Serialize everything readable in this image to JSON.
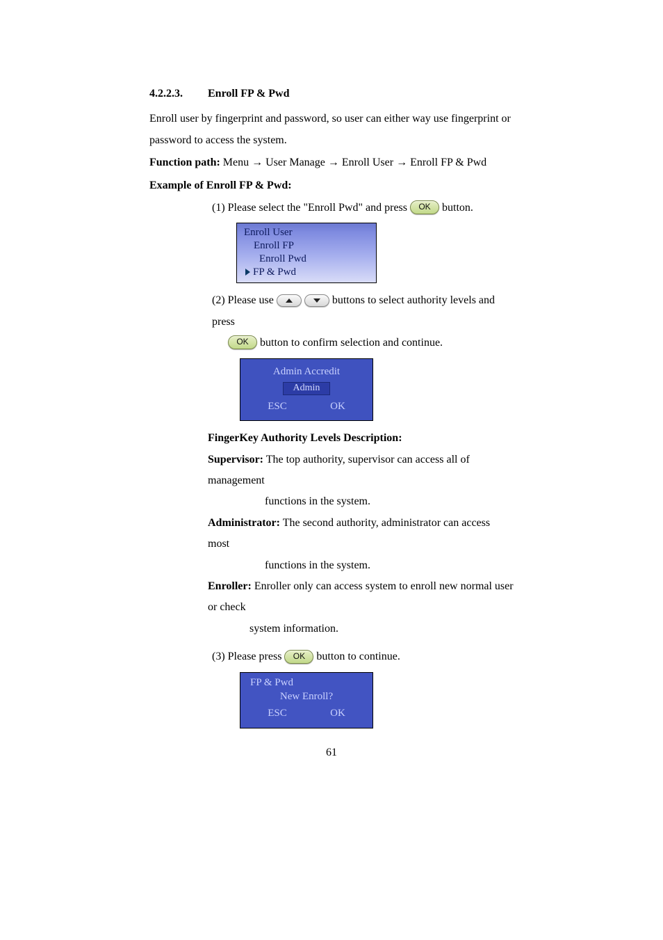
{
  "heading": {
    "number": "4.2.2.3.",
    "title": "Enroll FP & Pwd"
  },
  "intro": "Enroll user by fingerprint and password, so user can either way use fingerprint or password to access the system.",
  "fpath": {
    "label": "Function path:",
    "value": " Menu → User Manage → Enroll User → Enroll FP & Pwd"
  },
  "example_label": "Example of Enroll FP & Pwd:",
  "step1": {
    "pre": "(1) Please select the \"Enroll Pwd\" and press ",
    "post": " button.",
    "ok": "OK",
    "menu": {
      "title": "Enroll User",
      "item1": "Enroll FP",
      "item2": "Enroll Pwd",
      "item3": "FP  &  Pwd"
    }
  },
  "step2": {
    "pre": "(2) Please use ",
    "mid": " buttons to select authority levels and press",
    "line2": " button to confirm selection and continue.",
    "ok": "OK",
    "screen": {
      "title": "Admin Accredit",
      "sel": "Admin",
      "esc": "ESC",
      "ok": "OK"
    }
  },
  "auth": {
    "heading": "FingerKey Authority Levels Description:",
    "sup_label": "Supervisor:",
    "sup_text": " The top authority, supervisor can access all of management",
    "sup_text2": "functions in the system.",
    "adm_label": "Administrator:",
    "adm_text": " The second authority, administrator can access most",
    "adm_text2": "functions in the system.",
    "enr_label": "Enroller:",
    "enr_text": " Enroller only can access system to enroll new normal user or check",
    "enr_text2": "system information."
  },
  "step3": {
    "pre": "(3) Please press ",
    "post": " button to continue.",
    "ok": "OK",
    "screen": {
      "title": "FP  &  Pwd",
      "line": "New Enroll?",
      "esc": "ESC",
      "ok": "OK"
    }
  },
  "page_number": "61"
}
